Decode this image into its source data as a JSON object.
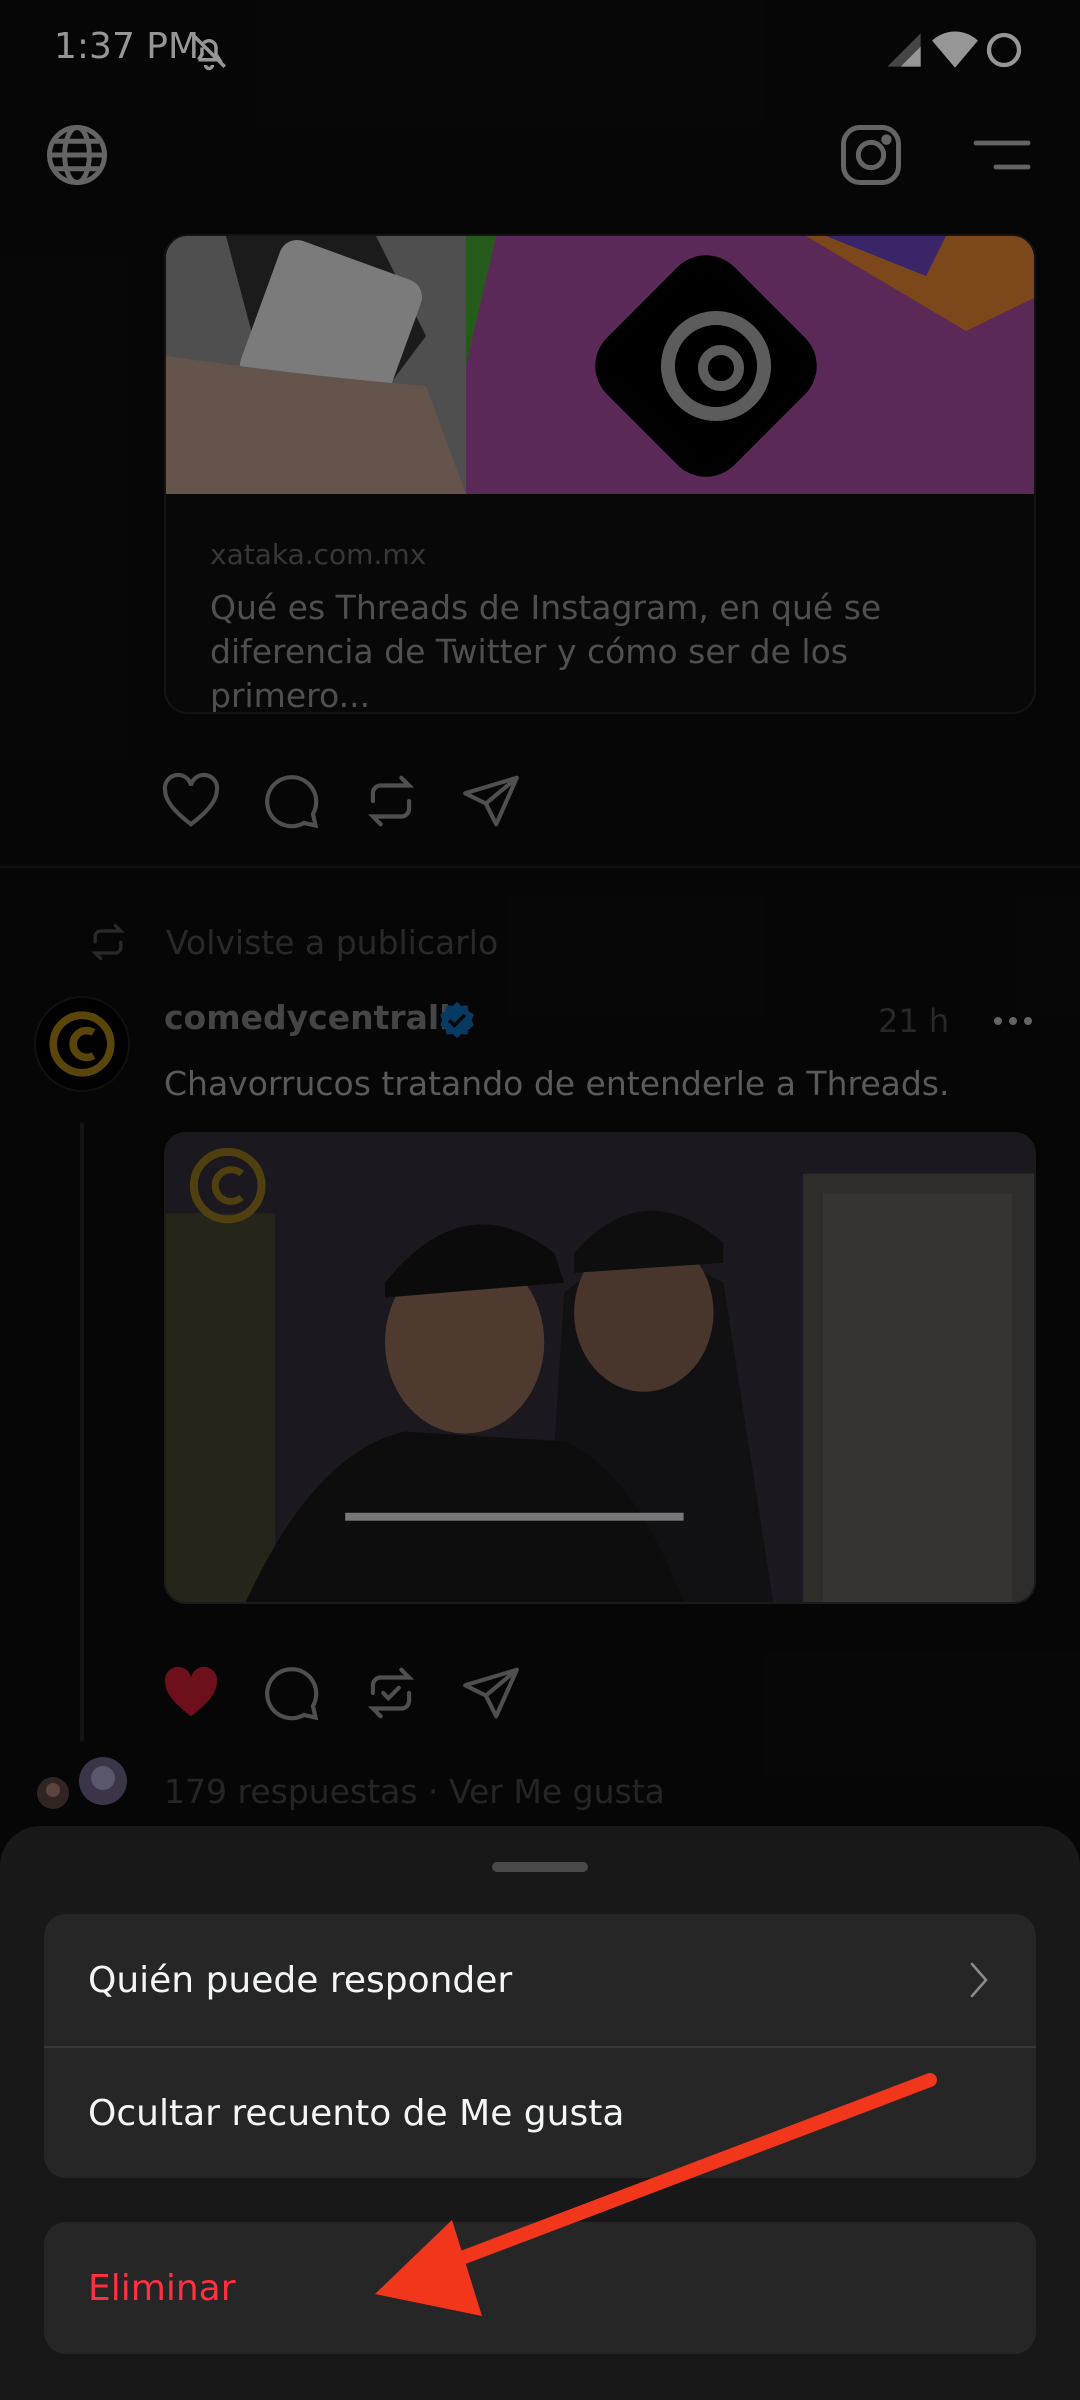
{
  "status_bar": {
    "time": "1:37 PM"
  },
  "feed": {
    "link_card": {
      "domain": "xataka.com.mx",
      "title": "Qué es Threads de Instagram, en qué se diferencia de Twitter y cómo ser de los primero..."
    },
    "repost_note": "Volviste a publicarlo",
    "post": {
      "username": "comedycentralla",
      "time": "21 h",
      "text": "Chavorrucos tratando de entenderle a Threads.",
      "stats": "179 respuestas · Ver Me gusta"
    }
  },
  "sheet": {
    "options": [
      {
        "label": "Quién puede responder"
      },
      {
        "label": "Ocultar recuento de Me gusta"
      }
    ],
    "delete_label": "Eliminar"
  },
  "colors": {
    "danger": "#ff3040",
    "like": "#ff3040",
    "verified": "#0095f6",
    "arrow": "#f2361c",
    "brand_yellow": "#d4a21a"
  }
}
